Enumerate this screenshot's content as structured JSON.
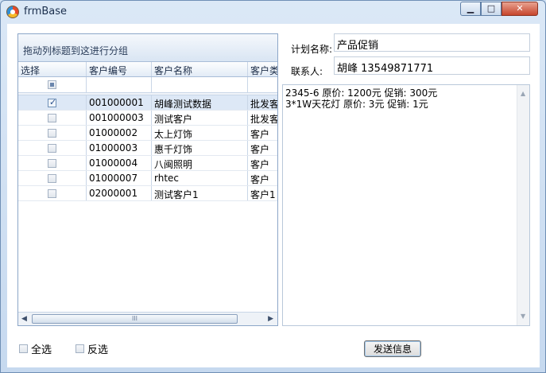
{
  "window": {
    "title": "frmBase",
    "min_symbol": "▁",
    "max_symbol": "□",
    "close_symbol": "✕"
  },
  "grid": {
    "group_panel_text": "拖动列标题到这进行分组",
    "columns": [
      "选择",
      "客户编号",
      "客户名称",
      "客户类"
    ],
    "rows": [
      {
        "checked": true,
        "code": "001000001",
        "name": "胡峰测试数据",
        "type": "批发客"
      },
      {
        "checked": false,
        "code": "001000003",
        "name": "测试客户",
        "type": "批发客"
      },
      {
        "checked": false,
        "code": "01000002",
        "name": "太上灯饰",
        "type": "客户"
      },
      {
        "checked": false,
        "code": "01000003",
        "name": "惠千灯饰",
        "type": "客户"
      },
      {
        "checked": false,
        "code": "01000004",
        "name": "八闽照明",
        "type": "客户"
      },
      {
        "checked": false,
        "code": "01000007",
        "name": "rhtec",
        "type": "客户"
      },
      {
        "checked": false,
        "code": "02000001",
        "name": "测试客户1",
        "type": "客户1"
      }
    ],
    "scroll_left": "◀",
    "scroll_right": "▶",
    "scroll_grip": "III"
  },
  "form": {
    "plan_label": "计划名称:",
    "plan_value": "产品促销",
    "contact_label": "联系人:",
    "contact_value": "胡峰  13549871771",
    "message_lines": [
      "2345-6 原价: 1200元 促销: 300元",
      "3*1W天花灯 原价: 3元 促销: 1元"
    ],
    "scroll_up": "▲",
    "scroll_down": "▼"
  },
  "footer": {
    "select_all_label": "全选",
    "invert_label": "反选",
    "send_button_label": "发送信息"
  }
}
